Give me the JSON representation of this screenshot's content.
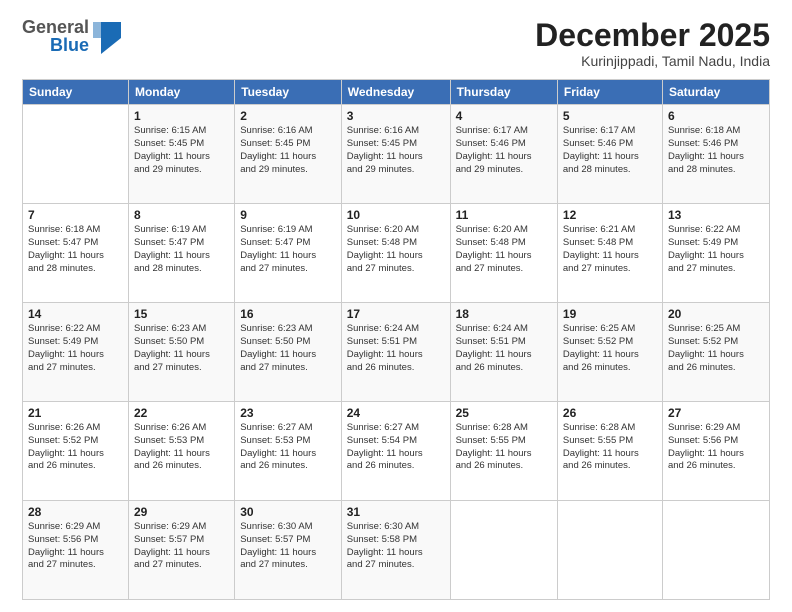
{
  "logo": {
    "general": "General",
    "blue": "Blue"
  },
  "title": "December 2025",
  "subtitle": "Kurinjippadi, Tamil Nadu, India",
  "header_days": [
    "Sunday",
    "Monday",
    "Tuesday",
    "Wednesday",
    "Thursday",
    "Friday",
    "Saturday"
  ],
  "weeks": [
    [
      {
        "day": "",
        "info": ""
      },
      {
        "day": "1",
        "info": "Sunrise: 6:15 AM\nSunset: 5:45 PM\nDaylight: 11 hours\nand 29 minutes."
      },
      {
        "day": "2",
        "info": "Sunrise: 6:16 AM\nSunset: 5:45 PM\nDaylight: 11 hours\nand 29 minutes."
      },
      {
        "day": "3",
        "info": "Sunrise: 6:16 AM\nSunset: 5:45 PM\nDaylight: 11 hours\nand 29 minutes."
      },
      {
        "day": "4",
        "info": "Sunrise: 6:17 AM\nSunset: 5:46 PM\nDaylight: 11 hours\nand 29 minutes."
      },
      {
        "day": "5",
        "info": "Sunrise: 6:17 AM\nSunset: 5:46 PM\nDaylight: 11 hours\nand 28 minutes."
      },
      {
        "day": "6",
        "info": "Sunrise: 6:18 AM\nSunset: 5:46 PM\nDaylight: 11 hours\nand 28 minutes."
      }
    ],
    [
      {
        "day": "7",
        "info": "Sunrise: 6:18 AM\nSunset: 5:47 PM\nDaylight: 11 hours\nand 28 minutes."
      },
      {
        "day": "8",
        "info": "Sunrise: 6:19 AM\nSunset: 5:47 PM\nDaylight: 11 hours\nand 28 minutes."
      },
      {
        "day": "9",
        "info": "Sunrise: 6:19 AM\nSunset: 5:47 PM\nDaylight: 11 hours\nand 27 minutes."
      },
      {
        "day": "10",
        "info": "Sunrise: 6:20 AM\nSunset: 5:48 PM\nDaylight: 11 hours\nand 27 minutes."
      },
      {
        "day": "11",
        "info": "Sunrise: 6:20 AM\nSunset: 5:48 PM\nDaylight: 11 hours\nand 27 minutes."
      },
      {
        "day": "12",
        "info": "Sunrise: 6:21 AM\nSunset: 5:48 PM\nDaylight: 11 hours\nand 27 minutes."
      },
      {
        "day": "13",
        "info": "Sunrise: 6:22 AM\nSunset: 5:49 PM\nDaylight: 11 hours\nand 27 minutes."
      }
    ],
    [
      {
        "day": "14",
        "info": "Sunrise: 6:22 AM\nSunset: 5:49 PM\nDaylight: 11 hours\nand 27 minutes."
      },
      {
        "day": "15",
        "info": "Sunrise: 6:23 AM\nSunset: 5:50 PM\nDaylight: 11 hours\nand 27 minutes."
      },
      {
        "day": "16",
        "info": "Sunrise: 6:23 AM\nSunset: 5:50 PM\nDaylight: 11 hours\nand 27 minutes."
      },
      {
        "day": "17",
        "info": "Sunrise: 6:24 AM\nSunset: 5:51 PM\nDaylight: 11 hours\nand 26 minutes."
      },
      {
        "day": "18",
        "info": "Sunrise: 6:24 AM\nSunset: 5:51 PM\nDaylight: 11 hours\nand 26 minutes."
      },
      {
        "day": "19",
        "info": "Sunrise: 6:25 AM\nSunset: 5:52 PM\nDaylight: 11 hours\nand 26 minutes."
      },
      {
        "day": "20",
        "info": "Sunrise: 6:25 AM\nSunset: 5:52 PM\nDaylight: 11 hours\nand 26 minutes."
      }
    ],
    [
      {
        "day": "21",
        "info": "Sunrise: 6:26 AM\nSunset: 5:52 PM\nDaylight: 11 hours\nand 26 minutes."
      },
      {
        "day": "22",
        "info": "Sunrise: 6:26 AM\nSunset: 5:53 PM\nDaylight: 11 hours\nand 26 minutes."
      },
      {
        "day": "23",
        "info": "Sunrise: 6:27 AM\nSunset: 5:53 PM\nDaylight: 11 hours\nand 26 minutes."
      },
      {
        "day": "24",
        "info": "Sunrise: 6:27 AM\nSunset: 5:54 PM\nDaylight: 11 hours\nand 26 minutes."
      },
      {
        "day": "25",
        "info": "Sunrise: 6:28 AM\nSunset: 5:55 PM\nDaylight: 11 hours\nand 26 minutes."
      },
      {
        "day": "26",
        "info": "Sunrise: 6:28 AM\nSunset: 5:55 PM\nDaylight: 11 hours\nand 26 minutes."
      },
      {
        "day": "27",
        "info": "Sunrise: 6:29 AM\nSunset: 5:56 PM\nDaylight: 11 hours\nand 26 minutes."
      }
    ],
    [
      {
        "day": "28",
        "info": "Sunrise: 6:29 AM\nSunset: 5:56 PM\nDaylight: 11 hours\nand 27 minutes."
      },
      {
        "day": "29",
        "info": "Sunrise: 6:29 AM\nSunset: 5:57 PM\nDaylight: 11 hours\nand 27 minutes."
      },
      {
        "day": "30",
        "info": "Sunrise: 6:30 AM\nSunset: 5:57 PM\nDaylight: 11 hours\nand 27 minutes."
      },
      {
        "day": "31",
        "info": "Sunrise: 6:30 AM\nSunset: 5:58 PM\nDaylight: 11 hours\nand 27 minutes."
      },
      {
        "day": "",
        "info": ""
      },
      {
        "day": "",
        "info": ""
      },
      {
        "day": "",
        "info": ""
      }
    ]
  ]
}
